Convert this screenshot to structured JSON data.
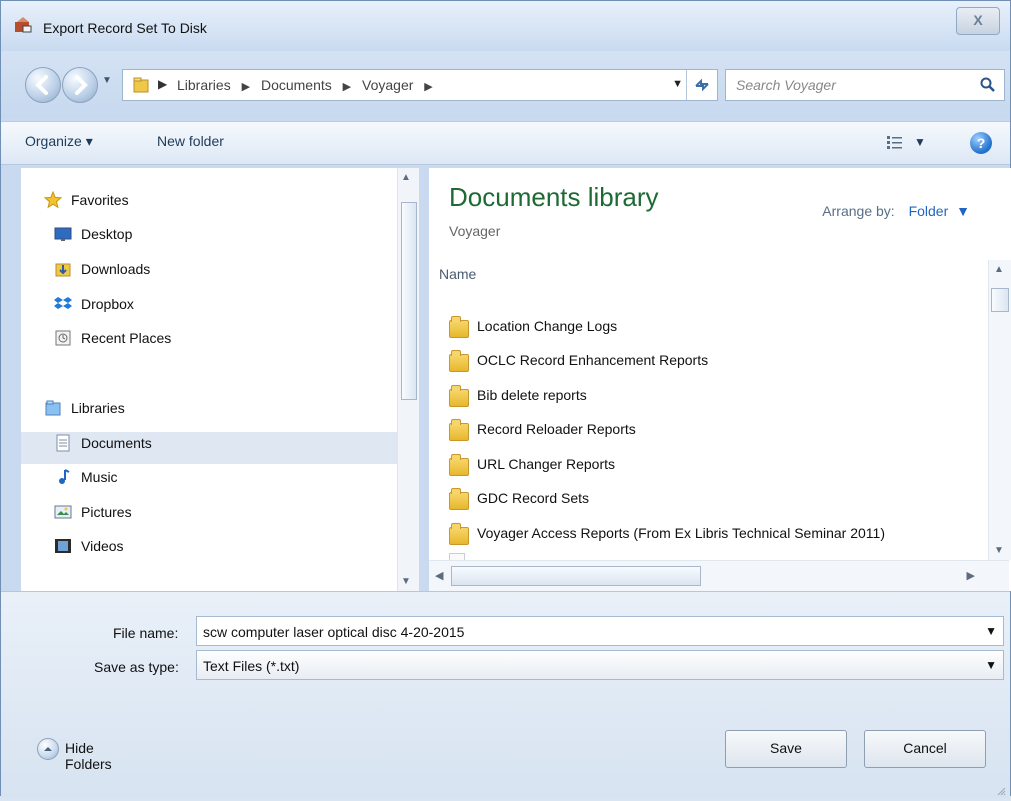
{
  "window": {
    "title": "Export Record Set To Disk",
    "close_label": "X"
  },
  "navigation": {
    "path": [
      "Libraries",
      "Documents",
      "Voyager"
    ],
    "search_placeholder": "Search Voyager"
  },
  "toolbar": {
    "organize_label": "Organize ▾",
    "new_folder_label": "New folder"
  },
  "sidebar": {
    "favorites_label": "Favorites",
    "favorites_items": [
      "Desktop",
      "Downloads",
      "Dropbox",
      "Recent Places"
    ],
    "libraries_label": "Libraries",
    "libraries_items": [
      "Documents",
      "Music",
      "Pictures",
      "Videos"
    ]
  },
  "main": {
    "library_title": "Documents library",
    "library_subtitle": "Voyager",
    "arrange_label": "Arrange by:",
    "arrange_value": "Folder",
    "name_header": "Name",
    "folders": [
      "Location Change Logs",
      "OCLC Record Enhancement Reports",
      "Bib delete reports",
      "Record Reloader Reports",
      "URL Changer Reports",
      "GDC Record Sets",
      "Voyager Access Reports (From Ex Libris Technical Seminar 2011)"
    ]
  },
  "bottom": {
    "file_name_label": "File name:",
    "file_name_value": "scw computer laser optical disc 4-20-2015",
    "save_type_label": "Save as type:",
    "save_type_value": "Text Files (*.txt)",
    "hide_folders_label": "Hide Folders",
    "save_button_label": "Save",
    "cancel_button_label": "Cancel"
  }
}
